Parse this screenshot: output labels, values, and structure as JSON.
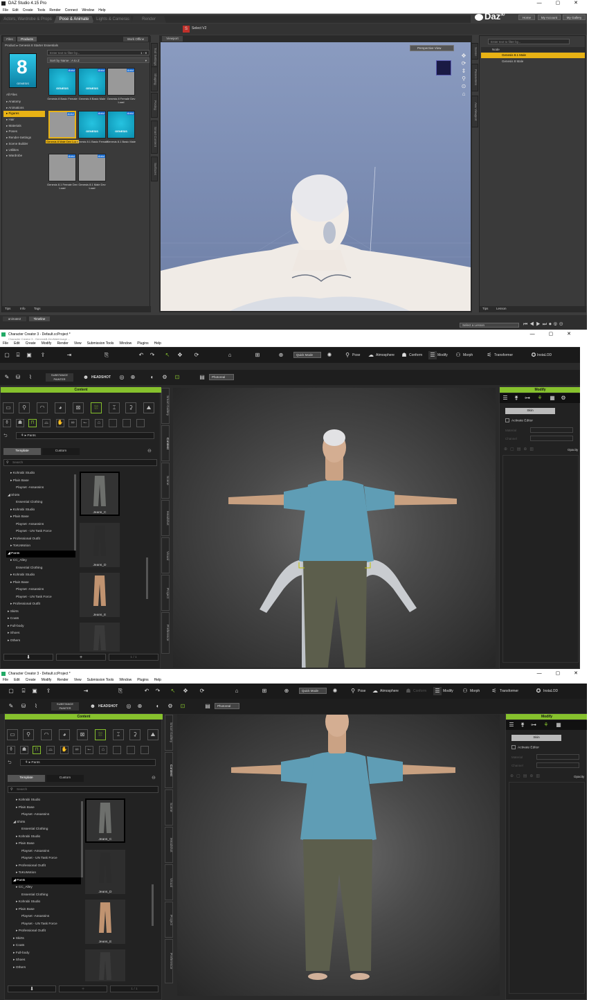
{
  "daz": {
    "title": "DAZ Studio 4.15 Pro",
    "menu": [
      "File",
      "Edit",
      "Create",
      "Tools",
      "Render",
      "Connect",
      "Window",
      "Help"
    ],
    "tabs": [
      "Actors, Wardrobe & Props",
      "Pose & Animate",
      "Lights & Cameras",
      "Render"
    ],
    "brand": "Daz",
    "brand_sup": "3D",
    "header_buttons": [
      "Home",
      "My Account",
      "My Gallery"
    ],
    "toolbar_label": "Select V2",
    "left_tabs": [
      "Files",
      "Products"
    ],
    "work_offline": "Work Offline",
    "product_label": "Product",
    "product_name": "Genesis 8 Starter Essentials",
    "filter_placeholder": "Enter text to filter by...",
    "filter_count": "1 - 8",
    "sort_label": "Sort by Name : A to Z",
    "product_logo": "GENESIS",
    "all_files": "All Files",
    "categories": [
      "Anatomy",
      "Animations",
      "Figures",
      "Hair",
      "Materials",
      "Poses",
      "Render-Settings",
      "Scene Builder",
      "Utilities",
      "Wardrobe"
    ],
    "selected_category": "Figures",
    "actor_badge": "Actor",
    "tile_logo": "GENESIS",
    "tiles": [
      "Genesis 8 Basic Female",
      "Genesis 8 Basic Male",
      "Genesis 8 Female Dev Load",
      "Genesis 8 Male Dev Load",
      "Genesis 8.1 Basic Female",
      "Genesis 8.1 Basic Male",
      "Genesis 8.1 Female Dev Load",
      "Genesis 8.1 Male Dev Load"
    ],
    "left_bottom_tabs": [
      "Tips",
      "Info",
      "Tags"
    ],
    "viewport_tab": "Viewport",
    "perspective_label": "Perspective View",
    "side_tabs_left": [
      "Tool Settings",
      "Shaping",
      "Posing",
      "Smart Content",
      "Surfaces"
    ],
    "side_tabs_right": [
      "Scene",
      "Parameters",
      "Aux Viewport"
    ],
    "scene_filter_placeholder": "Enter text to filter by...",
    "scene_header": "Node",
    "scene_items": [
      "Genesis 8.1 Male",
      "Genesis 8 Male"
    ],
    "right_bottom_tabs": [
      "Tips",
      "Lesson"
    ],
    "bottom_tabs": [
      "animate2",
      "Timeline"
    ],
    "lesson_select": "Select a Lesson"
  },
  "cc1": {
    "title": "Character Creator 3 - Default.ccProject *",
    "subtitle": "Character Creator 3 - GenesisB-DevMaleUsage ...",
    "menu": [
      "File",
      "Edit",
      "Create",
      "Modify",
      "Render",
      "View",
      "Submission Tools",
      "Window",
      "Plugins",
      "Help"
    ],
    "quick_mode": "Quick Mode",
    "tool_labels": [
      "Pose",
      "Atmosphere",
      "Conform",
      "Modify",
      "Morph",
      "Transformer",
      "InstaLOD"
    ],
    "substance": "SUBSTANCE PAINTER",
    "headshot": "HEADSHOT",
    "render_mode": "Photoreal",
    "content_header": "Content",
    "breadcrumb": "Pants",
    "tabs": [
      "Template",
      "Custom"
    ],
    "search_placeholder": "Search",
    "tree": [
      "Kohrabi Studio",
      "Plain Base",
      "Playset -Assassins",
      "Shirts",
      "Essential Clothing",
      "Kohrabi Studio",
      "Plain Base",
      "Playset -Assassins",
      "Playset - UN Task Force",
      "Professional Outfit",
      "ToKoMotion",
      "Pants",
      "CC_Alley",
      "Essential Clothing",
      "Kohrabi Studio",
      "Plain Base",
      "Playset -Assassins",
      "Playset - UN Task Force",
      "Professional Outfit",
      "Skirts",
      "Coats",
      "Full-body",
      "Shoes",
      "Others"
    ],
    "selected_tree": "Pants",
    "tiles": [
      "Jeans_C",
      "Jeans_D",
      "Jeans_E"
    ],
    "side_tabs": [
      "Smart Gallery",
      "Content",
      "Scene",
      "Headshot",
      "Visual",
      "Project",
      "Preference"
    ],
    "modify_header": "Modify",
    "skin_button": "Skin",
    "activate_editor": "Activate Editor",
    "fields": [
      "Material",
      "Channel"
    ],
    "opacity_label": "Opacity",
    "plus_label": "+",
    "counter": "1 / 1"
  },
  "cc2": {
    "title": "Character Creator 3 - Default.ccProject *",
    "menu": [
      "File",
      "Edit",
      "Create",
      "Modify",
      "Render",
      "View",
      "Submission Tools",
      "Window",
      "Plugins",
      "Help"
    ],
    "quick_mode": "Quick Mode",
    "tool_labels": [
      "Pose",
      "Atmosphere",
      "Conform",
      "Modify",
      "Morph",
      "Transformer",
      "InstaLOD"
    ],
    "substance": "SUBSTANCE PAINTER",
    "headshot": "HEADSHOT",
    "render_mode": "Photoreal",
    "content_header": "Content",
    "breadcrumb": "Pants",
    "tabs": [
      "Template",
      "Custom"
    ],
    "search_placeholder": "Search",
    "tree": [
      "Kohrabi Studio",
      "Plain Base",
      "Playset -Assassins",
      "Shirts",
      "Essential Clothing",
      "Kohrabi Studio",
      "Plain Base",
      "Playset -Assassins",
      "Playset - UN Task Force",
      "Professional Outfit",
      "ToKoMotion",
      "Pants",
      "CC_Alley",
      "Essential Clothing",
      "Kohrabi Studio",
      "Plain Base",
      "Playset -Assassins",
      "Playset - UN Task Force",
      "Professional Outfit",
      "Skirts",
      "Coats",
      "Full-body",
      "Shoes",
      "Others"
    ],
    "selected_tree": "Pants",
    "tiles": [
      "Jeans_C",
      "Jeans_D",
      "Jeans_E"
    ],
    "side_tabs": [
      "Smart Gallery",
      "Content",
      "Scene",
      "Headshot",
      "Visual",
      "Project",
      "Preference"
    ],
    "modify_header": "Modify",
    "skin_button": "Skin",
    "activate_editor": "Activate Editor",
    "fields": [
      "Material",
      "Channel"
    ],
    "opacity_label": "Opacity",
    "plus_label": "+",
    "counter": "1 / 1"
  },
  "colors": {
    "daz_accent": "#e8b215",
    "cc_accent": "#86c12d",
    "viewport_blue": "#7d8fb5"
  }
}
